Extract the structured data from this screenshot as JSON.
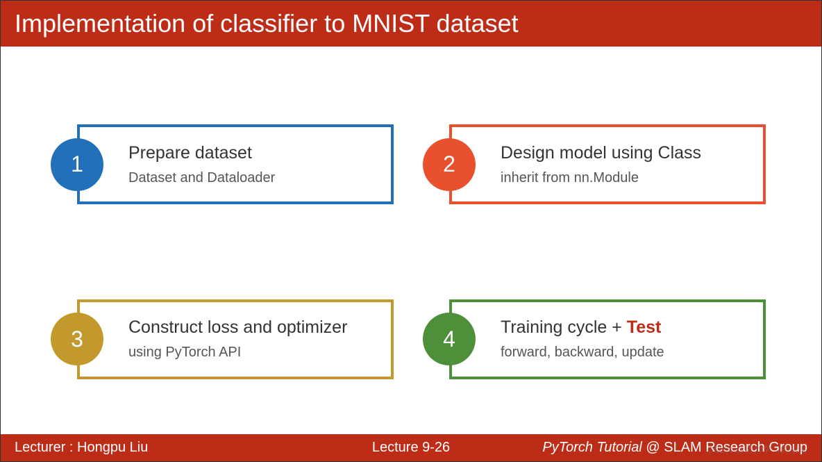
{
  "header": {
    "title": "Implementation of classifier to MNIST dataset"
  },
  "steps": {
    "step1": {
      "number": "1",
      "title": "Prepare dataset",
      "subtitle": "Dataset and Dataloader"
    },
    "step2": {
      "number": "2",
      "title": "Design model using Class",
      "subtitle": "inherit from nn.Module"
    },
    "step3": {
      "number": "3",
      "title": "Construct loss and optimizer",
      "subtitle": "using PyTorch API"
    },
    "step4": {
      "number": "4",
      "title_prefix": "Training cycle + ",
      "title_highlight": "Test",
      "subtitle": "forward, backward, update"
    }
  },
  "footer": {
    "lecturer_label": "Lecturer : Hongpu Liu",
    "lecture": "Lecture 9-26",
    "tutorial_italic": "PyTorch Tutorial",
    "tutorial_rest": " @ SLAM Research Group"
  },
  "watermark": "CSDN @努力学习的未来"
}
